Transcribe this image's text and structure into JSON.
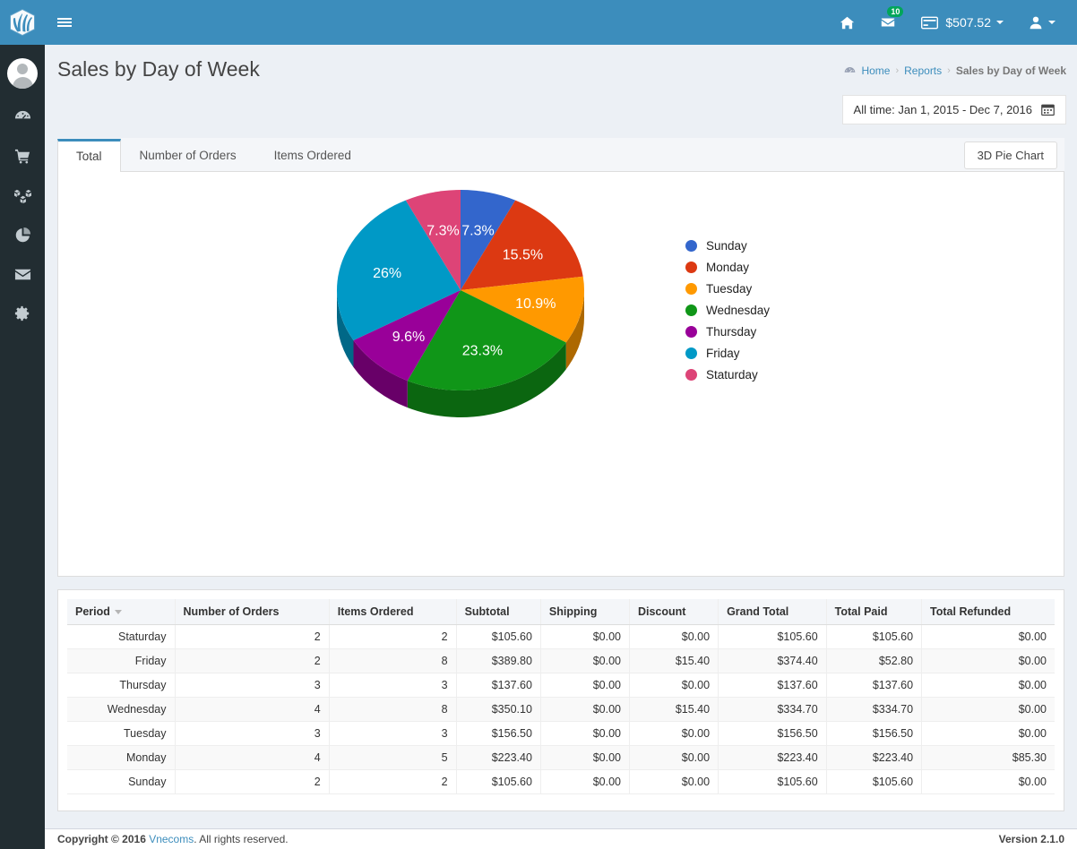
{
  "brand": {
    "logo_icon": "leaf-logo-icon",
    "header_color": "#3c8dbc",
    "sidebar_color": "#222d32"
  },
  "topbar": {
    "menu_toggle_icon": "hamburger-icon",
    "home_icon": "home-icon",
    "messages_icon": "envelope-icon",
    "messages_badge": "10",
    "balance_icon": "credit-card-icon",
    "balance_label": "$507.52",
    "user_icon": "user-icon"
  },
  "sidebar": {
    "items": [
      {
        "icon": "avatar-icon",
        "name": "avatar"
      },
      {
        "icon": "dashboard-gauge-icon",
        "name": "dashboard"
      },
      {
        "icon": "shopping-cart-icon",
        "name": "sales"
      },
      {
        "icon": "boxes-icon",
        "name": "products"
      },
      {
        "icon": "pie-chart-icon",
        "name": "reports"
      },
      {
        "icon": "envelope-icon",
        "name": "messages"
      },
      {
        "icon": "gear-icon",
        "name": "settings"
      }
    ]
  },
  "page": {
    "title": "Sales by Day of Week"
  },
  "breadcrumb": {
    "home_icon": "dashboard-home-icon",
    "items": [
      "Home",
      "Reports",
      "Sales by Day of Week"
    ],
    "separator": "›"
  },
  "daterange": {
    "label": "All time: Jan 1, 2015 - Dec 7, 2016",
    "icon": "calendar-icon"
  },
  "tabs": {
    "items": [
      {
        "label": "Total",
        "active": true
      },
      {
        "label": "Number of Orders",
        "active": false
      },
      {
        "label": "Items Ordered",
        "active": false
      }
    ],
    "action_button": "3D Pie Chart"
  },
  "chart_data": {
    "type": "pie",
    "title": "",
    "three_d": true,
    "legend_position": "right",
    "categories": [
      "Sunday",
      "Monday",
      "Tuesday",
      "Wednesday",
      "Thursday",
      "Friday",
      "Staturday"
    ],
    "values": [
      7.3,
      15.5,
      10.9,
      23.3,
      9.6,
      26.0,
      7.3
    ],
    "value_labels": [
      "7.3%",
      "15.5%",
      "10.9%",
      "23.3%",
      "9.6%",
      "26%",
      "7.3%"
    ],
    "unit": "percent",
    "colors": [
      "#3366cc",
      "#dc3912",
      "#ff9900",
      "#109618",
      "#990099",
      "#0099c6",
      "#dd4477"
    ],
    "legend": [
      "Sunday",
      "Monday",
      "Tuesday",
      "Wednesday",
      "Thursday",
      "Friday",
      "Staturday"
    ]
  },
  "table": {
    "columns": [
      "Period",
      "Number of Orders",
      "Items Ordered",
      "Subtotal",
      "Shipping",
      "Discount",
      "Grand Total",
      "Total Paid",
      "Total Refunded"
    ],
    "sorted_column": "Period",
    "sort_direction": "desc",
    "rows": [
      {
        "period": "Staturday",
        "orders": "2",
        "items": "2",
        "subtotal": "$105.60",
        "shipping": "$0.00",
        "discount": "$0.00",
        "grand_total": "$105.60",
        "total_paid": "$105.60",
        "total_refunded": "$0.00"
      },
      {
        "period": "Friday",
        "orders": "2",
        "items": "8",
        "subtotal": "$389.80",
        "shipping": "$0.00",
        "discount": "$15.40",
        "grand_total": "$374.40",
        "total_paid": "$52.80",
        "total_refunded": "$0.00"
      },
      {
        "period": "Thursday",
        "orders": "3",
        "items": "3",
        "subtotal": "$137.60",
        "shipping": "$0.00",
        "discount": "$0.00",
        "grand_total": "$137.60",
        "total_paid": "$137.60",
        "total_refunded": "$0.00"
      },
      {
        "period": "Wednesday",
        "orders": "4",
        "items": "8",
        "subtotal": "$350.10",
        "shipping": "$0.00",
        "discount": "$15.40",
        "grand_total": "$334.70",
        "total_paid": "$334.70",
        "total_refunded": "$0.00"
      },
      {
        "period": "Tuesday",
        "orders": "3",
        "items": "3",
        "subtotal": "$156.50",
        "shipping": "$0.00",
        "discount": "$0.00",
        "grand_total": "$156.50",
        "total_paid": "$156.50",
        "total_refunded": "$0.00"
      },
      {
        "period": "Monday",
        "orders": "4",
        "items": "5",
        "subtotal": "$223.40",
        "shipping": "$0.00",
        "discount": "$0.00",
        "grand_total": "$223.40",
        "total_paid": "$223.40",
        "total_refunded": "$85.30"
      },
      {
        "period": "Sunday",
        "orders": "2",
        "items": "2",
        "subtotal": "$105.60",
        "shipping": "$0.00",
        "discount": "$0.00",
        "grand_total": "$105.60",
        "total_paid": "$105.60",
        "total_refunded": "$0.00"
      }
    ]
  },
  "footer": {
    "copyright_prefix": "Copyright © 2016 ",
    "company": "Vnecoms",
    "copyright_suffix": ". All rights reserved.",
    "version": "Version 2.1.0"
  }
}
